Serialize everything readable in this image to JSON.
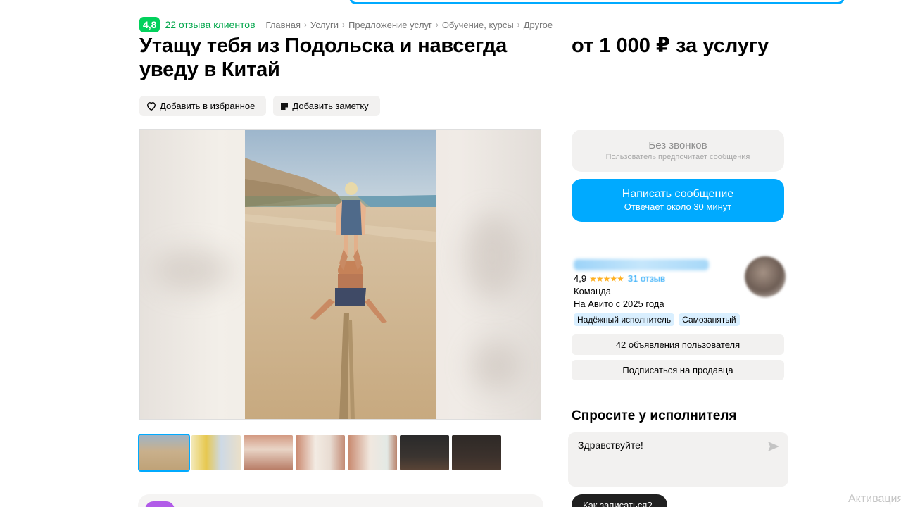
{
  "header": {
    "rating": "4,8",
    "reviews_link": "22 отзыва клиентов",
    "breadcrumbs": [
      "Главная",
      "Услуги",
      "Предложение услуг",
      "Обучение, курсы",
      "Другое"
    ]
  },
  "listing": {
    "title": "Утащу тебя из Подольска и навсегда уведу в Китай",
    "price": "от 1 000 ₽ за услугу",
    "add_favorite": "Добавить в избранное",
    "add_note": "Добавить заметку"
  },
  "gallery": {
    "thumbnail_count": 7,
    "active_index": 0
  },
  "contact": {
    "no_calls_title": "Без звонков",
    "no_calls_subtitle": "Пользователь предпочитает сообщения",
    "message_title": "Написать сообщение",
    "message_subtitle": "Отвечает около 30 минут"
  },
  "seller": {
    "rating": "4,9",
    "stars": 5,
    "reviews": "31 отзыв",
    "type": "Команда",
    "since": "На Авито с 2025 года",
    "badges": [
      "Надёжный исполнитель",
      "Самозанятый"
    ],
    "listings_button": "42 объявления пользователя",
    "subscribe_button": "Подписаться на продавца"
  },
  "ask": {
    "title": "Спросите у исполнителя",
    "message": "Здравствуйте!",
    "how_to": "Как записаться?"
  },
  "overlay": {
    "watermark": "Активация"
  },
  "colors": {
    "accent": "#00aaff",
    "rating_green": "#02d15c",
    "chip_bg": "#f2f1f0"
  }
}
